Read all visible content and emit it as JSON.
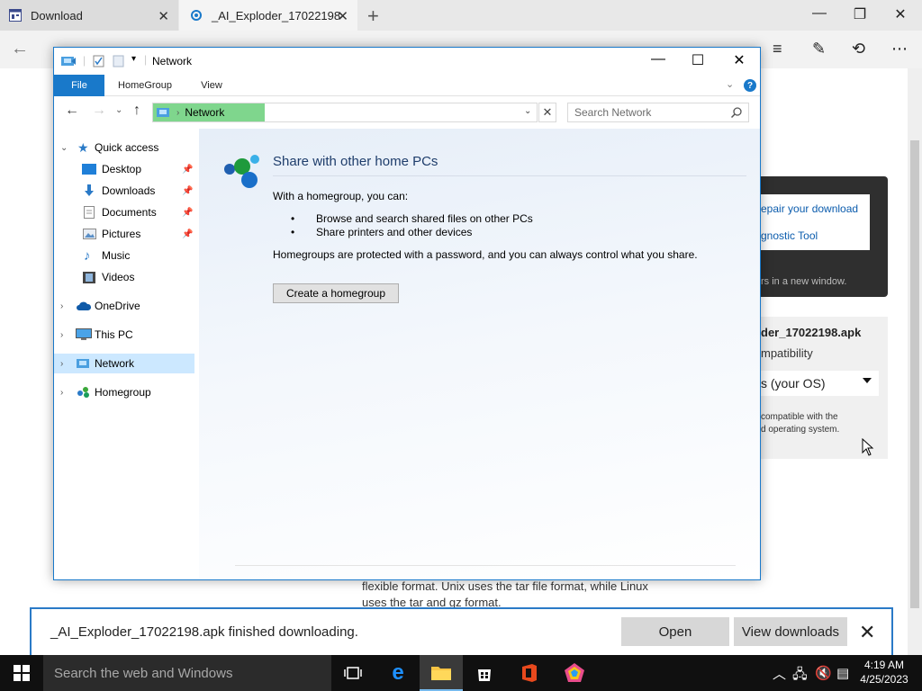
{
  "browser": {
    "tabs": [
      {
        "title": "Download"
      },
      {
        "title": "_AI_Exploder_17022198"
      }
    ]
  },
  "webpage": {
    "repair_link": "epair your download",
    "diagnostic_link": "gnostic Tool",
    "new_window_note": "rs in a new window.",
    "file_name": "der_17022198.apk",
    "compat_label": "mpatibility",
    "os_select": "s (your OS)",
    "compat_note_1": "compatible with the",
    "compat_note_2": "d operating system.",
    "body_text_1": "flexible format. Unix uses the tar file format, while Linux",
    "body_text_2": "uses the tar and gz format."
  },
  "download_bar": {
    "message": "_AI_Exploder_17022198.apk finished downloading.",
    "open_label": "Open",
    "view_downloads_label": "View downloads"
  },
  "explorer": {
    "title": "Network",
    "ribbon_tabs": [
      "File",
      "HomeGroup",
      "View"
    ],
    "address_crumb": "Network",
    "search_placeholder": "Search Network",
    "nav": {
      "quick_access": "Quick access",
      "desktop": "Desktop",
      "downloads": "Downloads",
      "documents": "Documents",
      "pictures": "Pictures",
      "music": "Music",
      "videos": "Videos",
      "onedrive": "OneDrive",
      "this_pc": "This PC",
      "network": "Network",
      "homegroup": "Homegroup"
    },
    "homegroup": {
      "title": "Share with other home PCs",
      "intro": "With a homegroup, you can:",
      "bullets": [
        "Browse and search shared files on other PCs",
        "Share printers and other devices"
      ],
      "note": "Homegroups are protected with a password, and you can always control what you share.",
      "button": "Create a homegroup"
    }
  },
  "taskbar": {
    "search_placeholder": "Search the web and Windows",
    "time": "4:19 AM",
    "date": "4/25/2023"
  }
}
